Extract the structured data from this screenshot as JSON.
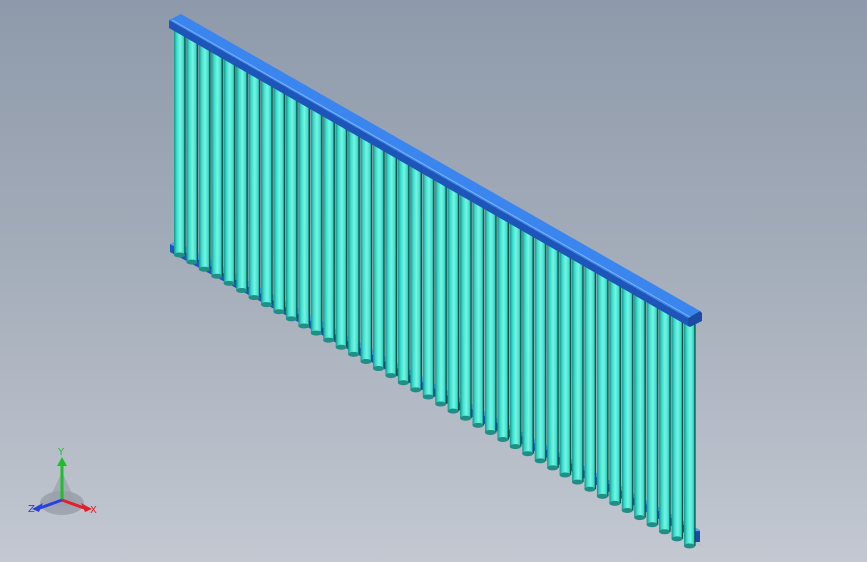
{
  "model": {
    "name": "louvered-panel",
    "tube_count": 42,
    "colors": {
      "frame": "#2f78e3",
      "frame_dark": "#1d56b8",
      "frame_light": "#5a9bf2",
      "tube": "#35e0cc",
      "tube_light": "#7af2e3",
      "tube_dark": "#1f8f86",
      "tube_edge": "#0e4f4a"
    }
  },
  "triad": {
    "y_label": "Y",
    "x_label": "X",
    "z_label": "Z",
    "colors": {
      "y": "#1fbf2a",
      "x": "#e0202a",
      "z": "#2a3fe0"
    }
  },
  "background": {
    "top": "#8e9aab",
    "bottom": "#c3c8d1"
  }
}
